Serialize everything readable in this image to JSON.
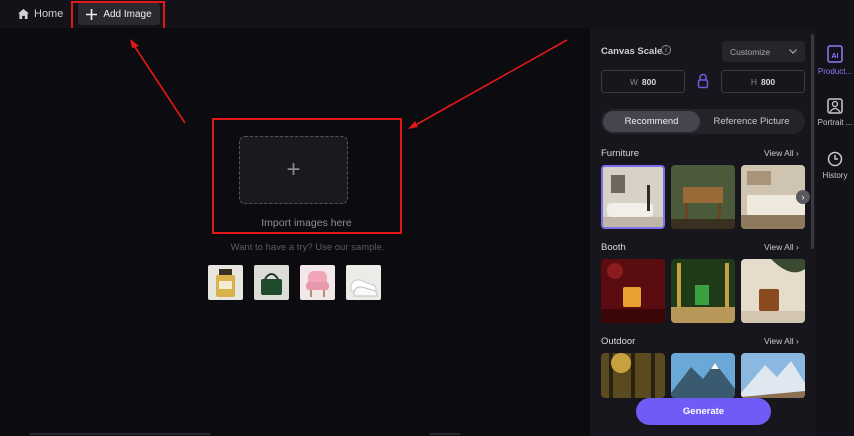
{
  "topbar": {
    "home_label": "Home",
    "add_image_label": "Add Image"
  },
  "canvas": {
    "import_label": "Import images here",
    "sample_hint": "Want to have a try? Use our sample.",
    "samples": [
      "perfume-bottle",
      "green-handbag",
      "pink-armchair",
      "white-sneakers"
    ]
  },
  "panel": {
    "canvas_scale_label": "Canvas Scale",
    "scale_mode": "Customize",
    "width_prefix": "W",
    "width_value": "800",
    "height_prefix": "H",
    "height_value": "800",
    "tabs": [
      {
        "label": "Recommend",
        "active": true
      },
      {
        "label": "Reference Picture",
        "active": false
      }
    ],
    "sections": [
      {
        "title": "Furniture",
        "view_all": "View All"
      },
      {
        "title": "Booth",
        "view_all": "View All"
      },
      {
        "title": "Outdoor",
        "view_all": "View All"
      }
    ],
    "generate_label": "Generate"
  },
  "rail": {
    "items": [
      {
        "label": "Product...",
        "icon": "ai-product-icon",
        "active": true
      },
      {
        "label": "Portrait ...",
        "icon": "portrait-icon",
        "active": false
      },
      {
        "label": "History",
        "icon": "history-clock-icon",
        "active": false
      }
    ]
  },
  "colors": {
    "accent": "#6f5cf6",
    "annotation_red": "#e01818",
    "background": "#0c0b10"
  }
}
